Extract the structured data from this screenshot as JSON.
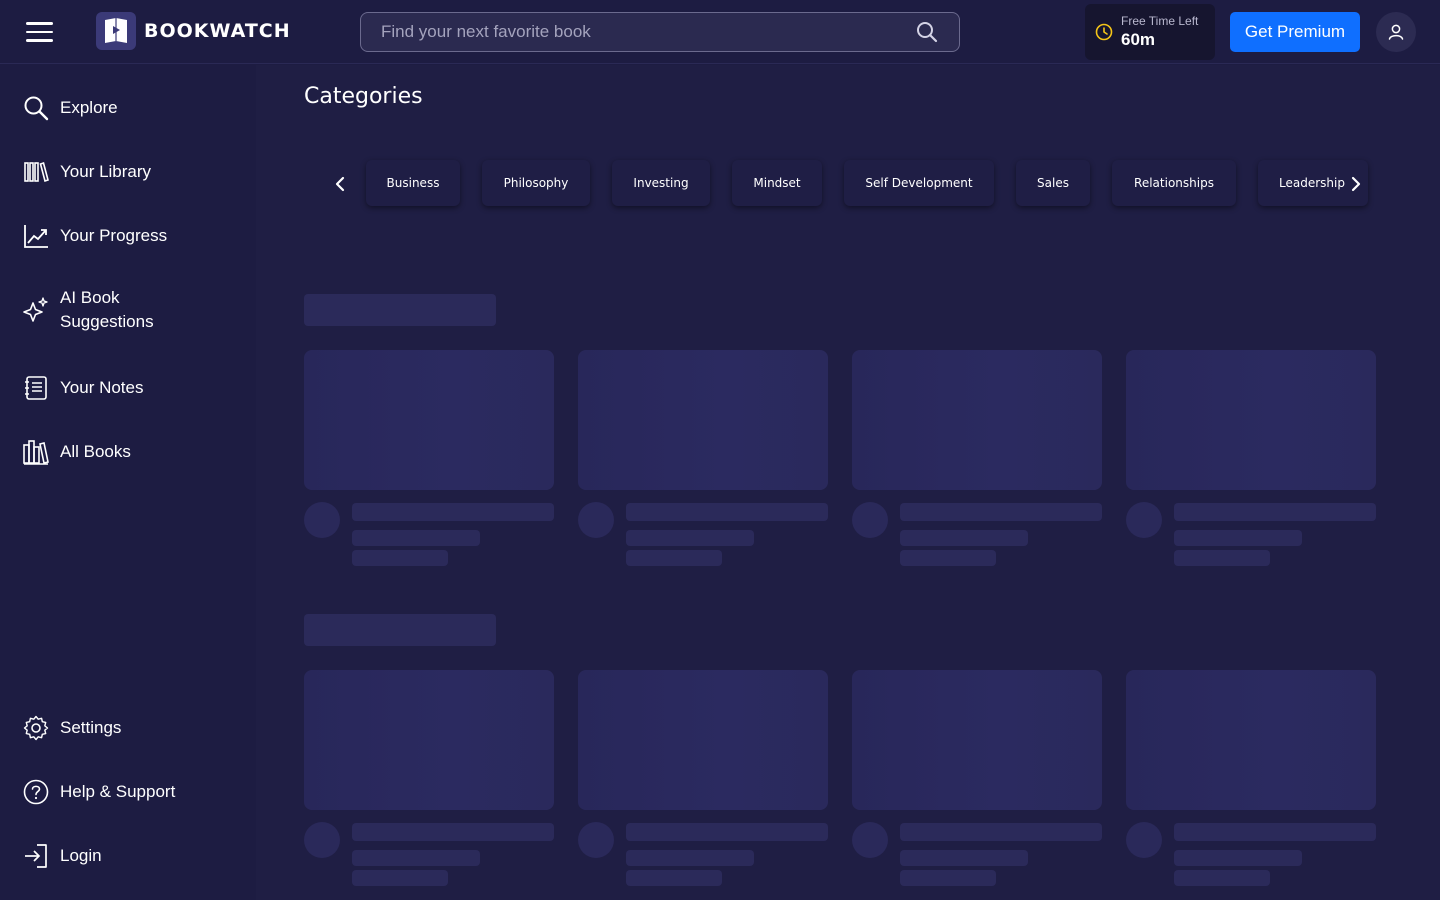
{
  "app": {
    "name": "BOOKWATCH"
  },
  "header": {
    "search_placeholder": "Find your next favorite book",
    "time_label": "Free Time Left",
    "time_value": "60m",
    "premium_label": "Get Premium"
  },
  "sidebar": {
    "items": [
      {
        "label": "Explore",
        "icon": "search-icon"
      },
      {
        "label": "Your Library",
        "icon": "library-icon"
      },
      {
        "label": "Your Progress",
        "icon": "chart-icon"
      },
      {
        "label": "AI Book Suggestions",
        "icon": "sparkle-icon"
      },
      {
        "label": "Your Notes",
        "icon": "notes-icon"
      },
      {
        "label": "All Books",
        "icon": "books-icon"
      }
    ],
    "bottom_items": [
      {
        "label": "Settings",
        "icon": "gear-icon"
      },
      {
        "label": "Help & Support",
        "icon": "help-icon"
      },
      {
        "label": "Login",
        "icon": "login-icon"
      }
    ]
  },
  "main": {
    "categories_title": "Categories",
    "categories": [
      "Business",
      "Philosophy",
      "Investing",
      "Mindset",
      "Self Development",
      "Sales",
      "Relationships",
      "Leadership"
    ]
  },
  "colors": {
    "background": "#1d1c42",
    "accent": "#0f6fff",
    "clock": "#f5c518"
  }
}
